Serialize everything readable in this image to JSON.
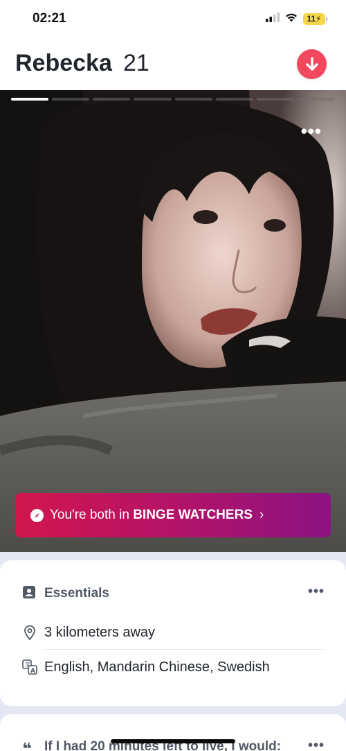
{
  "status_bar": {
    "time": "02:21",
    "battery": "11",
    "icons": [
      "cellular-signal-icon",
      "wifi-icon",
      "battery-charging-icon"
    ]
  },
  "header": {
    "name": "Rebecka",
    "age": "21",
    "collapse_icon": "arrow-down-icon",
    "accent_color": "#f3475e"
  },
  "photo": {
    "total_photos": 8,
    "current_photo": 1,
    "more_label": "•••",
    "shared_interest": {
      "prefix": "You're both in ",
      "group": "BINGE WATCHERS",
      "chevron": "›",
      "icon": "compass-icon",
      "gradient_colors": [
        "#d2164e",
        "#8b1382"
      ]
    }
  },
  "essentials": {
    "title": "Essentials",
    "more_label": "•••",
    "items": [
      {
        "icon": "location-pin-icon",
        "value": "3 kilometers away"
      },
      {
        "icon": "translate-icon",
        "value": "English, Mandarin Chinese, Swedish"
      }
    ]
  },
  "prompt": {
    "quote_mark": "❝",
    "title": "If I had 20 minutes left to live, I would:",
    "more_label": "•••"
  }
}
